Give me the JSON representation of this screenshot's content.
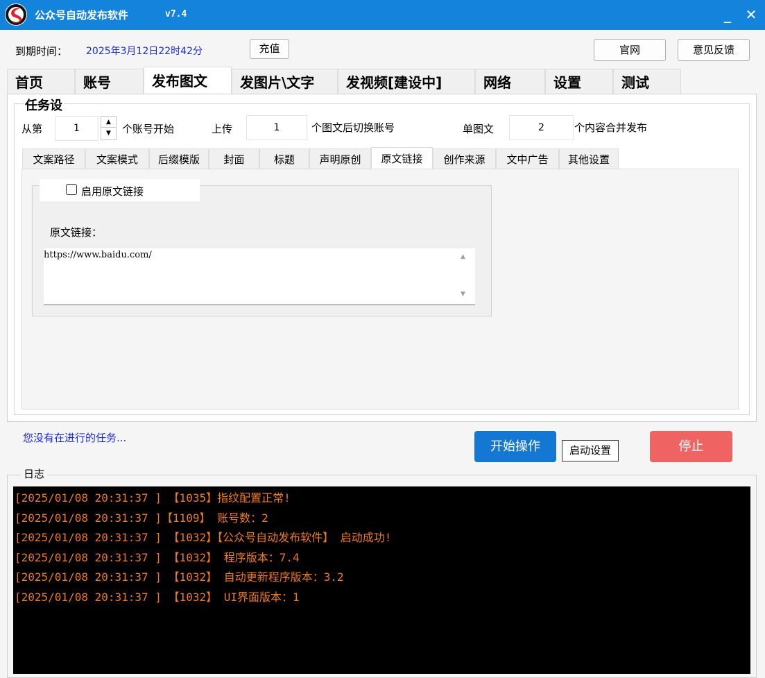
{
  "window": {
    "title": "公众号自动发布软件",
    "version": "v7.4",
    "logo_icon": "app-logo-icon",
    "minimize": "_",
    "close": "✕"
  },
  "header": {
    "expire_label": "到期时间：",
    "expire_value": "2025年3月12日22时42分",
    "recharge_label": "充值",
    "website_label": "官网",
    "feedback_label": "意见反馈"
  },
  "main_tabs": [
    {
      "label": "首页"
    },
    {
      "label": "账号"
    },
    {
      "label": "发布图文",
      "active": true
    },
    {
      "label": "发图片\\文字"
    },
    {
      "label": "发视频[建设中]"
    },
    {
      "label": "网络"
    },
    {
      "label": "设置"
    },
    {
      "label": "测试"
    }
  ],
  "task": {
    "legend": "任务设",
    "from_label": "从第",
    "start_account": "1",
    "start_account_suffix": "个账号开始",
    "upload_label": "上传",
    "upload_count": "1",
    "switch_suffix": "个图文后切换账号",
    "single_label": "单图文",
    "merge_count": "2",
    "merge_suffix": "个内容合并发布"
  },
  "sub_tabs": [
    {
      "label": "文案路径"
    },
    {
      "label": "文案模式"
    },
    {
      "label": "后缀模版"
    },
    {
      "label": "封面"
    },
    {
      "label": "标题"
    },
    {
      "label": "声明原创"
    },
    {
      "label": "原文链接",
      "active": true
    },
    {
      "label": "创作来源"
    },
    {
      "label": "文中广告"
    },
    {
      "label": "其他设置"
    }
  ],
  "original_link": {
    "enable_label": "启用原文链接",
    "enabled": false,
    "url_label": "原文链接：",
    "url_value": "https://www.baidu.com/"
  },
  "status": {
    "text": "您没有在进行的任务...",
    "start_label": "开始操作",
    "launch_settings_label": "启动设置",
    "stop_label": "停止"
  },
  "log": {
    "title": "日志",
    "lines": [
      "[2025/01/08 20:31:37 ] 【1035】指纹配置正常!",
      "[2025/01/08 20:31:37 ]【1109】 账号数：2",
      "[2025/01/08 20:31:37 ] 【1032】【公众号自动发布软件】 启动成功!",
      "[2025/01/08 20:31:37 ] 【1032】 程序版本：7.4",
      "[2025/01/08 20:31:37 ] 【1032】 自动更新程序版本：3.2",
      "[2025/01/08 20:31:37 ] 【1032】 UI界面版本：1"
    ]
  },
  "colors": {
    "titlebar": "#1383dc",
    "accent_text": "#1a2be0",
    "start_button": "#1477d4",
    "stop_button": "#f06363",
    "log_background": "#000000",
    "log_text": "#ee7a1f"
  }
}
